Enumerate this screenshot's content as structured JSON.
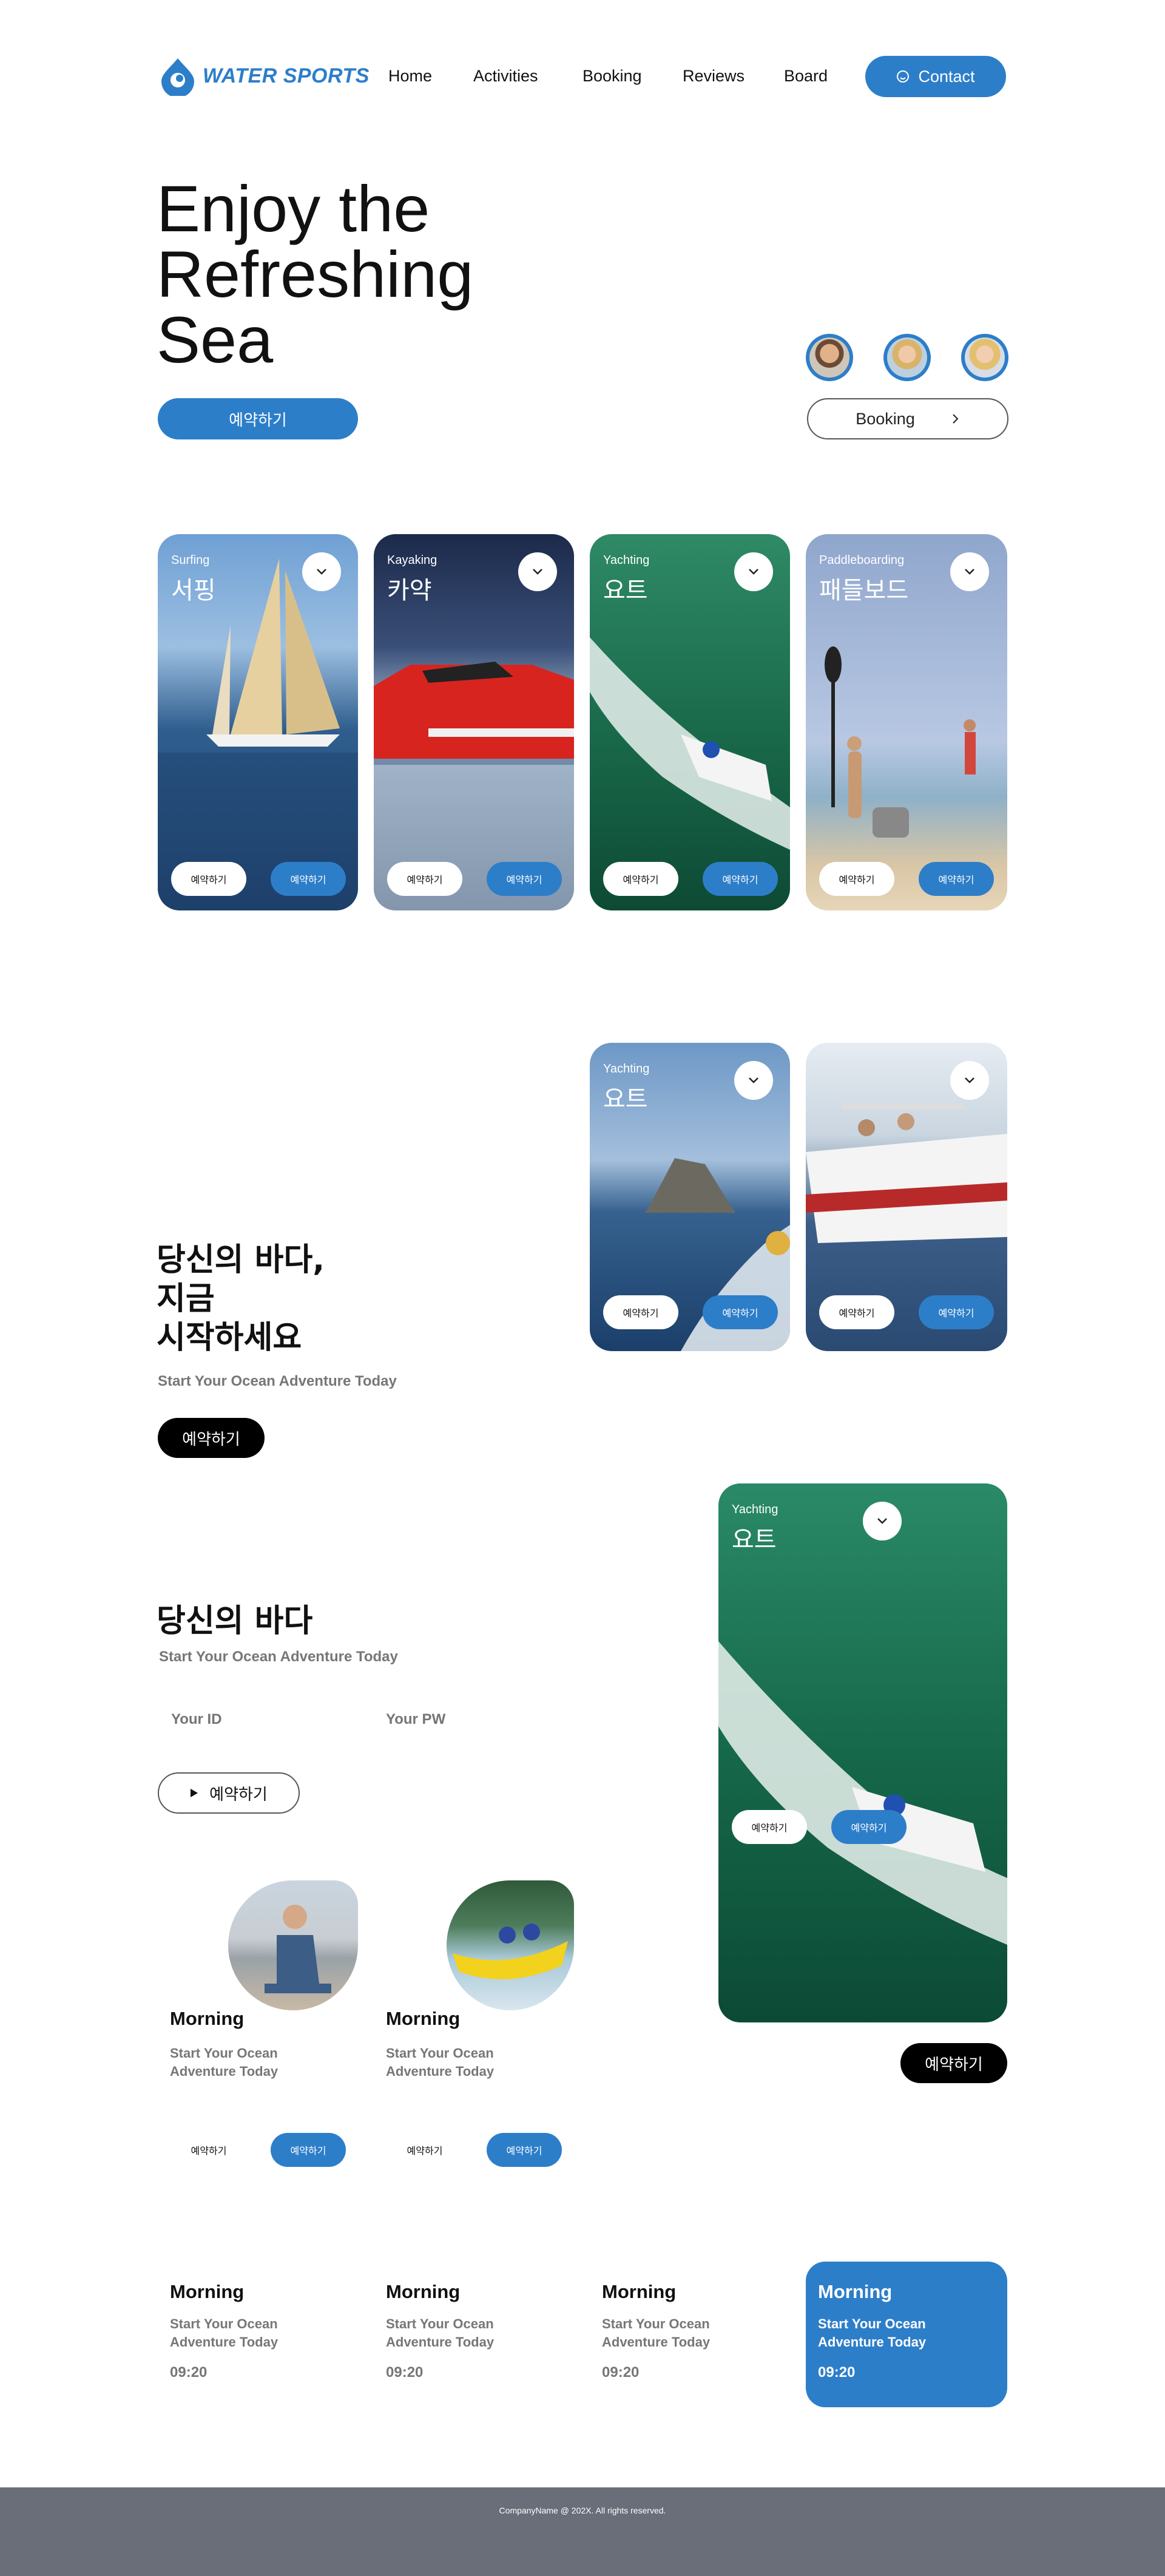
{
  "header": {
    "logo_text": "WATER SPORTS",
    "nav": [
      "Home",
      "Activities",
      "Booking",
      "Reviews",
      "Board"
    ],
    "contact_label": "Contact"
  },
  "hero": {
    "title_lines": [
      "Enjoy the",
      "Refreshing",
      "Sea"
    ],
    "book_button": "예약하기",
    "booking_button": "Booking"
  },
  "activities": [
    {
      "en": "Surfing",
      "ko": "서핑",
      "btn_detail": "예약하기",
      "btn_book": "예약하기"
    },
    {
      "en": "Kayaking",
      "ko": "카약",
      "btn_detail": "예약하기",
      "btn_book": "예약하기"
    },
    {
      "en": "Yachting",
      "ko": "요트",
      "btn_detail": "예약하기",
      "btn_book": "예약하기"
    },
    {
      "en": "Paddleboarding",
      "ko": "패들보드",
      "btn_detail": "예약하기",
      "btn_book": "예약하기"
    }
  ],
  "promo": {
    "title_lines": [
      "당신의 바다,",
      "지금",
      "시작하세요"
    ],
    "subtitle": "Start Your Ocean Adventure Today",
    "button": "예약하기",
    "cards": [
      {
        "en": "Yachting",
        "ko": "요트",
        "btn_detail": "예약하기",
        "btn_book": "예약하기"
      },
      {
        "en": "",
        "ko": "",
        "btn_detail": "예약하기",
        "btn_book": "예약하기"
      }
    ]
  },
  "login": {
    "title": "당신의 바다",
    "subtitle": "Start Your Ocean Adventure Today",
    "id_placeholder": "Your ID",
    "pw_placeholder": "Your PW",
    "play_button": "예약하기"
  },
  "big_card": {
    "en": "Yachting",
    "ko": "요트",
    "btn_detail": "예약하기",
    "btn_book": "예약하기",
    "below_button": "예약하기"
  },
  "session_cards": [
    {
      "title": "Morning",
      "desc_lines": [
        "Start Your Ocean",
        "Adventure Today"
      ],
      "btn_detail": "예약하기",
      "btn_book": "예약하기"
    },
    {
      "title": "Morning",
      "desc_lines": [
        "Start Your Ocean",
        "Adventure Today"
      ],
      "btn_detail": "예약하기",
      "btn_book": "예약하기"
    }
  ],
  "schedule": [
    {
      "title": "Morning",
      "desc_lines": [
        "Start Your Ocean",
        "Adventure Today"
      ],
      "time": "09:20"
    },
    {
      "title": "Morning",
      "desc_lines": [
        "Start Your Ocean",
        "Adventure Today"
      ],
      "time": "09:20"
    },
    {
      "title": "Morning",
      "desc_lines": [
        "Start Your Ocean",
        "Adventure Today"
      ],
      "time": "09:20"
    },
    {
      "title": "Morning",
      "desc_lines": [
        "Start Your Ocean",
        "Adventure Today"
      ],
      "time": "09:20",
      "active": true
    }
  ],
  "footer": {
    "text": "CompanyName @ 202X. All rights reserved."
  },
  "colors": {
    "accent": "#2d7ec9",
    "footer": "#6a6e79",
    "black": "#000000"
  }
}
